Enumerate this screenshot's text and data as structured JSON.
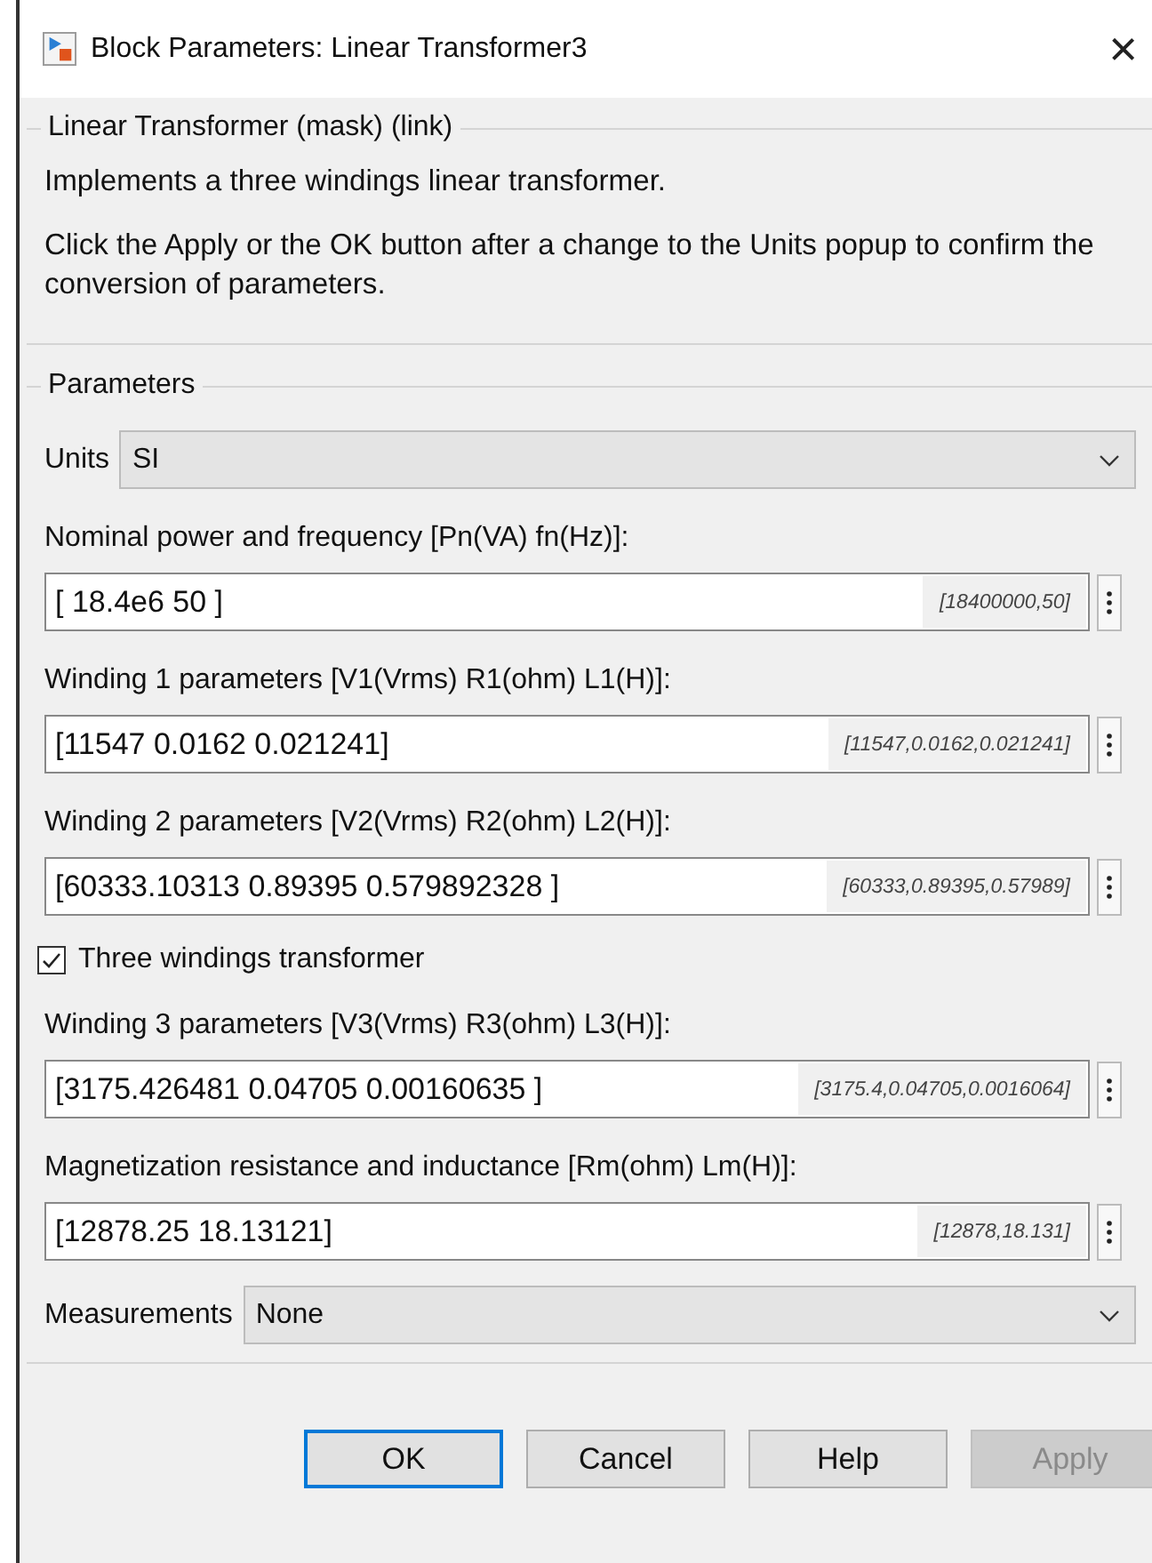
{
  "window": {
    "title": "Block Parameters: Linear Transformer3",
    "close": "×"
  },
  "description_group": {
    "title": "Linear Transformer (mask) (link)",
    "paragraphs": [
      "Implements a three windings linear transformer.",
      "Click the Apply or the OK button after a change to the Units popup to confirm the conversion of parameters."
    ]
  },
  "parameters": {
    "title": "Parameters",
    "items": [
      {
        "kind": "dropdown",
        "label": "Units",
        "value": "SI"
      },
      {
        "kind": "field",
        "label": "Nominal power and frequency [Pn(VA) fn(Hz)]:",
        "value": "[ 18.4e6 50 ]",
        "evaluated": "[18400000,50]"
      },
      {
        "kind": "field",
        "label": "Winding 1 parameters [V1(Vrms) R1(ohm) L1(H)]:",
        "value": "[11547 0.0162 0.021241]",
        "evaluated": "[11547,0.0162,0.021241]"
      },
      {
        "kind": "field",
        "label": "Winding 2 parameters [V2(Vrms) R2(ohm) L2(H)]:",
        "value": "[60333.10313 0.89395 0.579892328 ]",
        "evaluated": "[60333,0.89395,0.57989]"
      },
      {
        "kind": "checkbox",
        "label": "Three windings transformer",
        "checked": true
      },
      {
        "kind": "field",
        "label": "Winding 3 parameters [V3(Vrms) R3(ohm) L3(H)]:",
        "value": "[3175.426481 0.04705 0.00160635 ]",
        "evaluated": "[3175.4,0.04705,0.0016064]"
      },
      {
        "kind": "field",
        "label": "Magnetization resistance and inductance [Rm(ohm) Lm(H)]:",
        "value": "[12878.25 18.13121]",
        "evaluated": "[12878,18.131]"
      },
      {
        "kind": "dropdown",
        "label": "Measurements",
        "value": "None"
      }
    ]
  },
  "buttons": [
    {
      "label": "OK",
      "default": true,
      "disabled": false
    },
    {
      "label": "Cancel",
      "default": false,
      "disabled": false
    },
    {
      "label": "Help",
      "default": false,
      "disabled": false
    },
    {
      "label": "Apply",
      "default": false,
      "disabled": true
    }
  ]
}
